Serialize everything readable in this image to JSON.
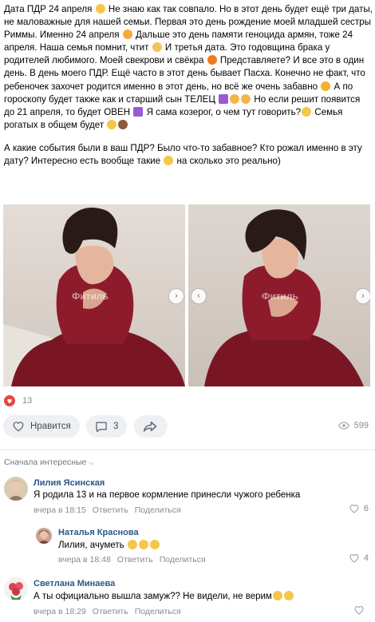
{
  "post": {
    "paragraphs": [
      [
        {
          "t": "Дата ПДР 24 апреля "
        },
        {
          "e": "baby-face-emoji",
          "c": "#f6c64a"
        },
        {
          "t": " Не знаю как так совпало. Но в этот день будет ещё три даты, не маловажные для нашей семьи. Первая это день рождение моей младшей сестры Риммы. Именно 24 апреля "
        },
        {
          "e": "smiling-hearts-emoji",
          "c": "#f4a93a"
        },
        {
          "t": " Дальше это день памяти геноцида армян, тоже 24 апреля. Наша семья помнит, чтит "
        },
        {
          "e": "praying-hands-emoji",
          "c": "#f2c35a"
        },
        {
          "t": " И третья дата. Это годовщина брака у родителей любимого. Моей свекрови и свёкра "
        },
        {
          "e": "orange-heart-emoji",
          "c": "#f07a1e"
        },
        {
          "t": " Представляете? И все это в один день. В день моего ПДР. Ещё часто в этот день бывает Пасха. Конечно не факт, что ребеночек захочет родится именно в этот день, но всё же очень забавно "
        },
        {
          "e": "sweat-smile-emoji",
          "c": "#f6b02c"
        },
        {
          "t": " А по гороскопу будет также как и старший сын ТЕЛЕЦ "
        },
        {
          "e": "taurus-sign-emoji",
          "c": "#9b59d6",
          "sq": true
        },
        {
          "e": "hands-emoji",
          "c": "#f3b54b"
        },
        {
          "e": "ok-hand-emoji",
          "c": "#f3b54b"
        },
        {
          "t": "  Но если решит появится до 21 апреля, то будет ОВЕН "
        },
        {
          "e": "aries-sign-emoji",
          "c": "#9b59d6",
          "sq": true
        },
        {
          "t": " Я сама козерог, о чем тут говорить?"
        },
        {
          "e": "grimacing-emoji",
          "c": "#f6c64a"
        },
        {
          "t": " Семья рогатых в общем будет "
        },
        {
          "e": "laughing-emoji",
          "c": "#f6c64a"
        },
        {
          "e": "thumbs-up-emoji",
          "c": "#8d5a3b"
        }
      ],
      [
        {
          "t": "А какие события были в ваш ПДР? Было что-то забавное? Кто рожал именно в эту дату? Интересно есть вообще такие "
        },
        {
          "e": "smirk-emoji",
          "c": "#f6c64a"
        },
        {
          "t": " на сколько это реально)"
        }
      ]
    ],
    "watermark": "Фитиль",
    "likes_count": "13",
    "actions": {
      "like_label": "Нравится",
      "comments_count": "3",
      "views_count": "599"
    }
  },
  "comments": {
    "sort_label": "Сначала интересные",
    "items": [
      {
        "author": "Лилия Ясинская",
        "text": "Я родила 13 и на первое кормление принесли чужого ребенка",
        "time": "вчера в 18:15",
        "reply_label": "Ответить",
        "share_label": "Поделиться",
        "likes": "6",
        "avatar_color": "#c9b79a"
      },
      {
        "author": "Наталья Краснова",
        "text": "Лилия, ачуметь",
        "emoji_tail": [
          "screaming-face-emoji",
          "screaming-face-emoji",
          "screaming-face-emoji"
        ],
        "time": "вчера в 18:48",
        "reply_label": "Ответить",
        "share_label": "Поделиться",
        "likes": "4",
        "avatar_color": "#b48a78"
      },
      {
        "author": "Светлана Минаева",
        "text": "А ты официально вышла замуж?? Не видели, не верим",
        "emoji_tail": [
          "rofl-emoji",
          "rofl-emoji"
        ],
        "time": "вчера в 18:29",
        "reply_label": "Ответить",
        "share_label": "Поделиться",
        "likes": "",
        "avatar_color": "#d9444f"
      }
    ]
  }
}
